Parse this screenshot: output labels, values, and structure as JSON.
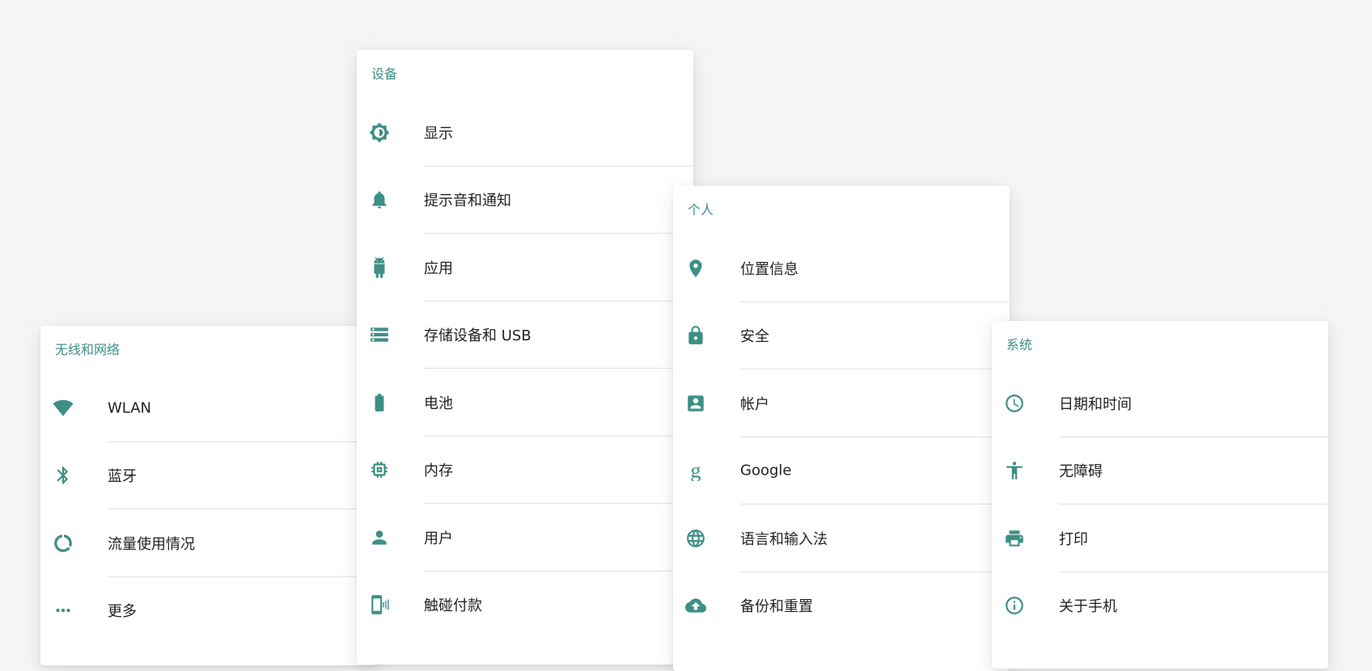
{
  "colors": {
    "accent": "#3d8f85",
    "background": "#f5f5f5",
    "card": "#ffffff",
    "text": "#222222",
    "divider": "#e2e2e2"
  },
  "wireless": {
    "title": "无线和网络",
    "items": [
      {
        "label": "WLAN",
        "icon": "wifi-icon"
      },
      {
        "label": "蓝牙",
        "icon": "bluetooth-icon"
      },
      {
        "label": "流量使用情况",
        "icon": "data-usage-icon"
      },
      {
        "label": "更多",
        "icon": "more-dots-icon"
      }
    ]
  },
  "device": {
    "title": "设备",
    "items": [
      {
        "label": "显示",
        "icon": "brightness-icon"
      },
      {
        "label": "提示音和通知",
        "icon": "bell-icon"
      },
      {
        "label": "应用",
        "icon": "android-icon"
      },
      {
        "label": "存储设备和 USB",
        "icon": "storage-icon"
      },
      {
        "label": "电池",
        "icon": "battery-icon"
      },
      {
        "label": "内存",
        "icon": "memory-icon"
      },
      {
        "label": "用户",
        "icon": "person-icon"
      },
      {
        "label": "触碰付款",
        "icon": "tap-pay-icon"
      }
    ]
  },
  "personal": {
    "title": "个人",
    "items": [
      {
        "label": "位置信息",
        "icon": "location-pin-icon"
      },
      {
        "label": "安全",
        "icon": "lock-icon"
      },
      {
        "label": "帐户",
        "icon": "account-box-icon"
      },
      {
        "label": "Google",
        "icon": "google-g-icon"
      },
      {
        "label": "语言和输入法",
        "icon": "globe-icon"
      },
      {
        "label": "备份和重置",
        "icon": "cloud-upload-icon"
      }
    ]
  },
  "system": {
    "title": "系统",
    "items": [
      {
        "label": "日期和时间",
        "icon": "clock-icon"
      },
      {
        "label": "无障碍",
        "icon": "accessibility-icon"
      },
      {
        "label": "打印",
        "icon": "printer-icon"
      },
      {
        "label": "关于手机",
        "icon": "info-icon"
      }
    ]
  }
}
